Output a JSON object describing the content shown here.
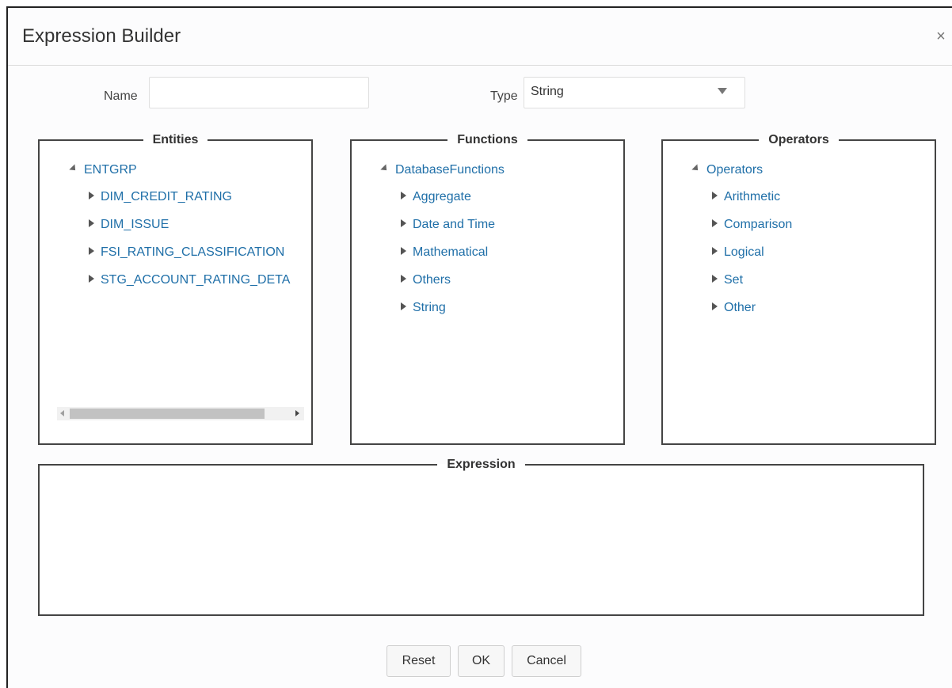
{
  "dialog": {
    "title": "Expression Builder",
    "close_glyph": "×"
  },
  "form": {
    "name_label": "Name",
    "name_value": "",
    "type_label": "Type",
    "type_value": "String"
  },
  "entities": {
    "legend": "Entities",
    "root": "ENTGRP",
    "items": [
      "DIM_CREDIT_RATING",
      "DIM_ISSUE",
      "FSI_RATING_CLASSIFICATION",
      "STG_ACCOUNT_RATING_DETA"
    ]
  },
  "functions": {
    "legend": "Functions",
    "root": "DatabaseFunctions",
    "items": [
      "Aggregate",
      "Date and Time",
      "Mathematical",
      "Others",
      "String"
    ]
  },
  "operators": {
    "legend": "Operators",
    "root": "Operators",
    "items": [
      "Arithmetic",
      "Comparison",
      "Logical",
      "Set",
      "Other"
    ]
  },
  "expression": {
    "legend": "Expression",
    "value": ""
  },
  "buttons": {
    "reset": "Reset",
    "ok": "OK",
    "cancel": "Cancel"
  },
  "icons": {
    "close": "close-icon",
    "dropdown": "chevron-down-icon",
    "expanded": "tree-expanded-icon",
    "collapsed": "tree-collapsed-icon"
  }
}
